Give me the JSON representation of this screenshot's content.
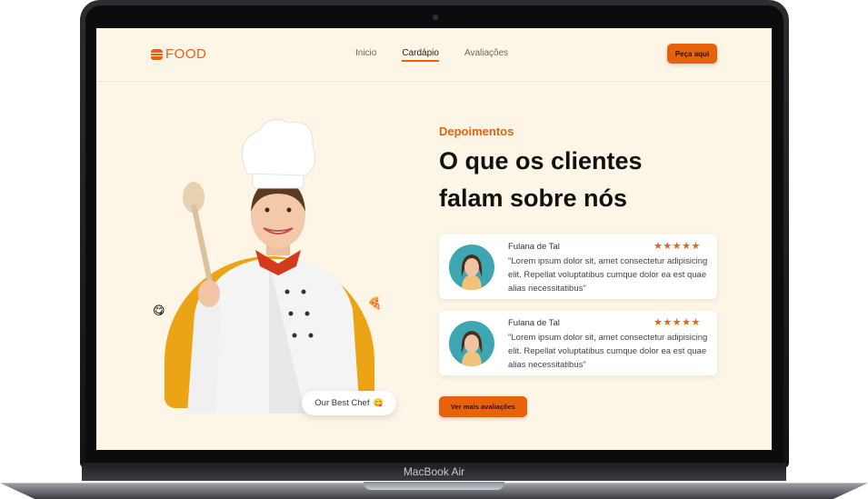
{
  "nav": {
    "logo_text": "FOOD",
    "links": [
      "Inicio",
      "Cardápio",
      "Avaliações"
    ],
    "active_link": "Cardápio",
    "order_button": "Peça aqui"
  },
  "hero": {
    "chef_badge": "Our Best Chef",
    "chef_badge_emoji": "😋",
    "emoji_left": "😋",
    "emoji_right": "🍕"
  },
  "testimonials": {
    "eyebrow": "Depoimentos",
    "heading": "O que os clientes falam sobre nós",
    "cards": [
      {
        "name": "Fulana de Tal",
        "stars": "★★★★★",
        "rating": 5,
        "quote": "\"Lorem ipsum dolor sit, amet consectetur adipisicing elit. Repellat voluptatibus cumque dolor ea est quae alias necessitatibus\""
      },
      {
        "name": "Fulana de Tal",
        "stars": "★★★★★",
        "rating": 5,
        "quote": "\"Lorem ipsum dolor sit, amet consectetur adipisicing elit. Repellat voluptatibus cumque dolor ea est quae alias necessitatibus\""
      }
    ],
    "more_button": "Ver mais avaliações"
  },
  "device": {
    "label": "MacBook Air"
  },
  "colors": {
    "accent": "#e8620c",
    "background": "#fdf6e6",
    "yellow": "#eaa415"
  }
}
